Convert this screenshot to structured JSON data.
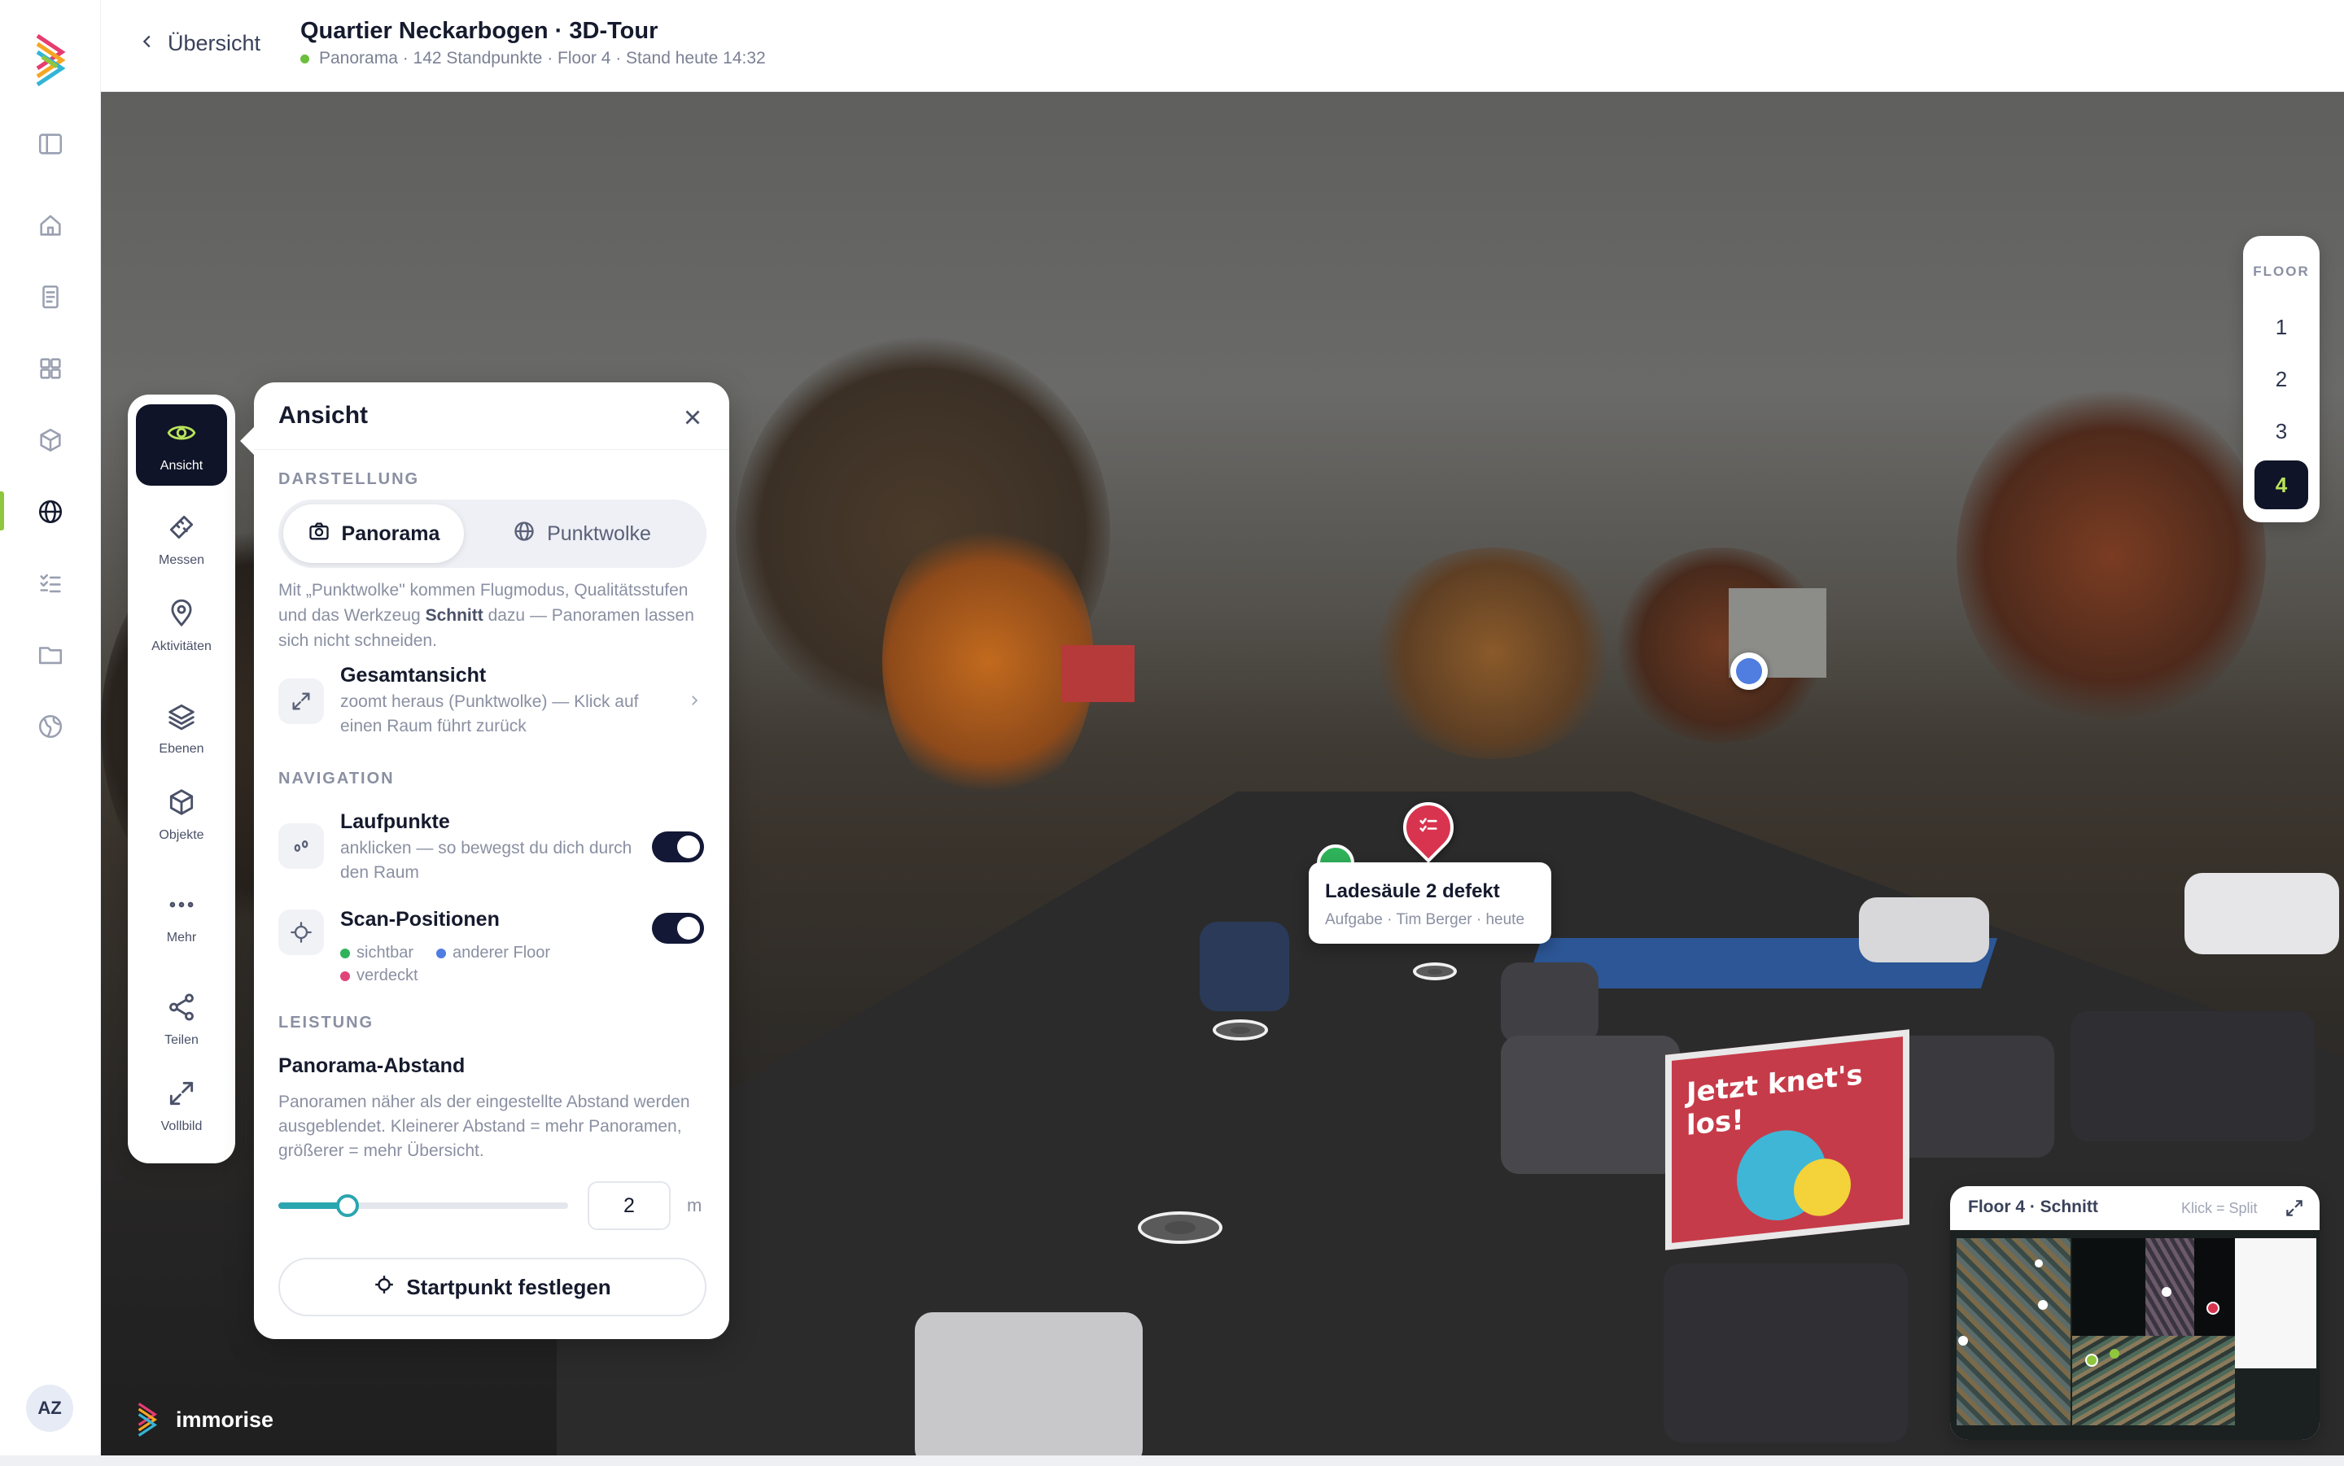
{
  "header": {
    "back_label": "Übersicht",
    "title": "Quartier Neckarbogen · 3D-Tour",
    "subtitle": "Panorama · 142 Standpunkte · Floor 4 · Stand heute 14:32"
  },
  "rail": {
    "icons": [
      "sidebar-toggle-icon",
      "home-icon",
      "document-icon",
      "dashboard-icon",
      "cube-icon",
      "globe-icon",
      "checklist-icon",
      "folder-icon",
      "world-icon"
    ],
    "active": "globe-icon",
    "avatar_initials": "AZ"
  },
  "tools": [
    {
      "label": "Ansicht",
      "icon": "eye-icon",
      "active": true
    },
    {
      "label": "Messen",
      "icon": "ruler-icon"
    },
    {
      "label": "Aktivitäten",
      "icon": "location-pin-icon"
    },
    {
      "label": "Ebenen",
      "icon": "layers-icon"
    },
    {
      "label": "Objekte",
      "icon": "box-icon"
    },
    {
      "label": "Mehr",
      "icon": "more-icon"
    },
    {
      "label": "Teilen",
      "icon": "share-icon"
    },
    {
      "label": "Vollbild",
      "icon": "fullscreen-icon"
    }
  ],
  "panel": {
    "title": "Ansicht",
    "darstellung_label": "DARSTELLUNG",
    "seg_panorama": "Panorama",
    "seg_punktwolke": "Punktwolke",
    "hint_part1": "Mit „Punktwolke\" kommen Flugmodus, Qualitätsstufen und das Werkzeug ",
    "hint_bold": "Schnitt",
    "hint_part2": " dazu — Panoramen lassen sich nicht schneiden.",
    "gesamt_title": "Gesamtansicht",
    "gesamt_desc": "zoomt heraus (Punktwolke) — Klick auf einen Raum führt zurück",
    "navigation_label": "NAVIGATION",
    "lauf_title": "Laufpunkte",
    "lauf_desc": "anklicken — so bewegst du dich durch den Raum",
    "lauf_on": true,
    "scan_title": "Scan-Positionen",
    "scan_on": true,
    "legend_visible": "sichtbar",
    "legend_other": "anderer Floor",
    "legend_hidden": "verdeckt",
    "leistung_label": "LEISTUNG",
    "abstand_title": "Panorama-Abstand",
    "abstand_desc": "Panoramen näher als der eingestellte Abstand werden ausgeblendet. Kleinerer Abstand = mehr Panoramen, größerer = mehr Übersicht.",
    "abstand_value": "2",
    "abstand_unit": "m",
    "abstand_fraction": 0.24,
    "cta_label": "Startpunkt festlegen"
  },
  "floors": {
    "label": "FLOOR",
    "items": [
      "1",
      "2",
      "3",
      "4"
    ],
    "active": "4"
  },
  "annotation": {
    "title": "Ladesäule 2 defekt",
    "subtitle": "Aufgabe · Tim Berger · heute"
  },
  "scene": {
    "billboard_text": "Jetzt knet's los!"
  },
  "minimap": {
    "title": "Floor 4 · Schnitt",
    "hint": "Klick = Split"
  },
  "brand": {
    "name": "immorise"
  },
  "colors": {
    "accent_green": "#8fc63e",
    "active_dark": "#0f1428",
    "slider": "#2aa6b0",
    "marker_red": "#d9344f",
    "marker_blue": "#4f7de0",
    "marker_green": "#2fb35a"
  }
}
